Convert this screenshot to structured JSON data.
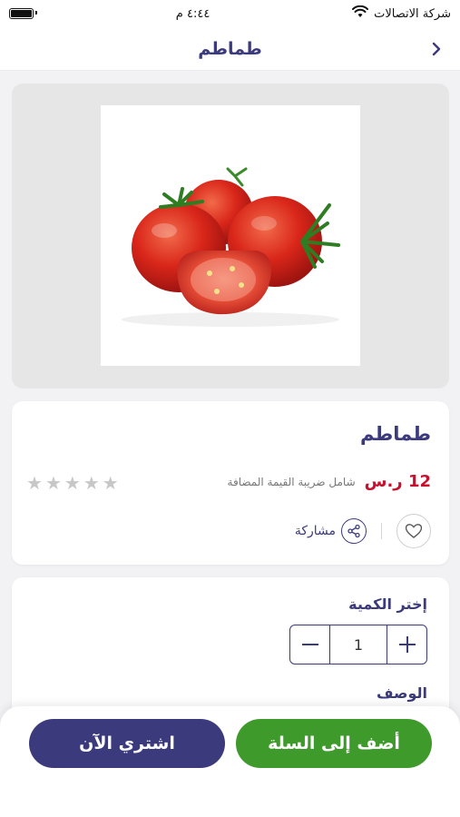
{
  "status_bar": {
    "carrier": "شركة الاتصالات",
    "time": "٤:٤٤ م"
  },
  "header": {
    "title": "طماطم"
  },
  "product": {
    "name": "طماطم",
    "price": "12 ر.س",
    "vat_note": "شامل ضريبة القيمة المضافة",
    "rating": 0,
    "rating_max": 5,
    "share_label": "مشاركة"
  },
  "quantity": {
    "title": "إختر الكمية",
    "value": "1"
  },
  "description": {
    "title": "الوصف"
  },
  "actions": {
    "add_to_cart": "أضف إلى السلة",
    "buy_now": "اشتري الآن"
  },
  "colors": {
    "brand": "#3b3a7d",
    "price": "#c8102e",
    "cart_button": "#3f9a2c"
  }
}
